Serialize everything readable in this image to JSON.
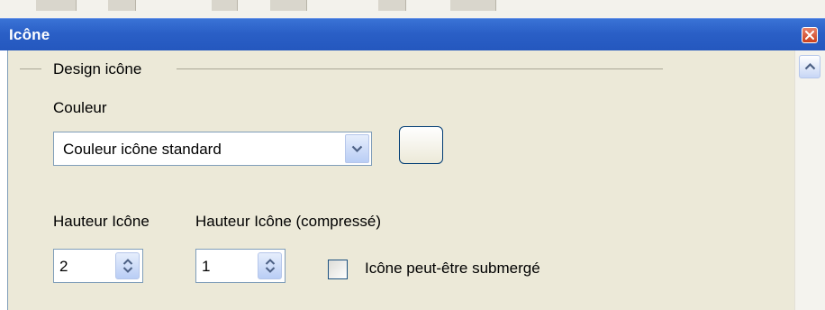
{
  "window": {
    "title": "Icône"
  },
  "design_group": {
    "title": "Design icône"
  },
  "color": {
    "label": "Couleur",
    "selected": "Couleur icône standard"
  },
  "height": {
    "label": "Hauteur Icône",
    "value": "2"
  },
  "height_compressed": {
    "label": "Hauteur Icône (compressé)",
    "value": "1"
  },
  "submerge": {
    "label": "Icône peut-être submergé",
    "checked": false
  },
  "icons": {
    "close": "close-icon",
    "scroll_up": "chevron-up-icon",
    "dropdown": "chevron-down-icon",
    "spin": "spin-arrows-icon"
  },
  "colors": {
    "titlebar": "#2a5fc6",
    "panel": "#ece9d8",
    "field_border": "#7f9db9",
    "close": "#c9401d"
  }
}
